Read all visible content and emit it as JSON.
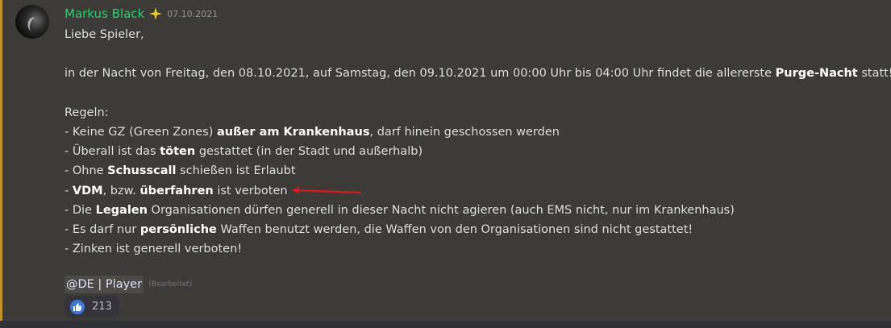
{
  "message": {
    "author": "Markus Black",
    "timestamp": "07.10.2021",
    "badge_icon": "sparkle-icon",
    "lines": [
      {
        "segments": [
          {
            "text": "Liebe Spieler,",
            "bold": false
          }
        ]
      },
      {
        "segments": []
      },
      {
        "segments": [
          {
            "text": "in der Nacht von Freitag, den 08.10.2021, auf Samstag, den 09.10.2021 um 00:00 Uhr bis 04:00 Uhr findet die allererste ",
            "bold": false
          },
          {
            "text": "Purge-Nacht",
            "bold": true
          },
          {
            "text": " statt!",
            "bold": false
          }
        ]
      },
      {
        "segments": []
      },
      {
        "segments": [
          {
            "text": "Regeln:",
            "bold": false
          }
        ]
      },
      {
        "segments": [
          {
            "text": "- Keine GZ (Green Zones) ",
            "bold": false
          },
          {
            "text": "außer am Krankenhaus",
            "bold": true
          },
          {
            "text": ", darf hinein geschossen werden",
            "bold": false
          }
        ]
      },
      {
        "segments": [
          {
            "text": "- Überall ist das ",
            "bold": false
          },
          {
            "text": "töten",
            "bold": true
          },
          {
            "text": " gestattet (in der Stadt und außerhalb)",
            "bold": false
          }
        ]
      },
      {
        "segments": [
          {
            "text": "- Ohne ",
            "bold": false
          },
          {
            "text": "Schusscall",
            "bold": true
          },
          {
            "text": " schießen ist Erlaubt",
            "bold": false
          }
        ]
      },
      {
        "segments": [
          {
            "text": "- ",
            "bold": false
          },
          {
            "text": "VDM",
            "bold": true
          },
          {
            "text": ", bzw. ",
            "bold": false
          },
          {
            "text": "überfahren",
            "bold": true
          },
          {
            "text": " ist verboten",
            "bold": false
          }
        ]
      },
      {
        "segments": [
          {
            "text": "- Die ",
            "bold": false
          },
          {
            "text": "Legalen",
            "bold": true
          },
          {
            "text": " Organisationen dürfen generell in dieser Nacht nicht agieren (auch EMS nicht, nur im Krankenhaus)",
            "bold": false
          }
        ]
      },
      {
        "segments": [
          {
            "text": "- Es darf nur ",
            "bold": false
          },
          {
            "text": "persönliche",
            "bold": true
          },
          {
            "text": " Waffen benutzt werden, die Waffen von den Organisationen sind nicht gestattet!",
            "bold": false
          }
        ]
      },
      {
        "segments": [
          {
            "text": "- Zinken ist generell verboten!",
            "bold": false
          }
        ]
      },
      {
        "segments": []
      }
    ],
    "mention": "@DE | Player",
    "edited_label": "(Bearbeitet)",
    "reaction": {
      "emoji_icon": "thumbs-up-icon",
      "count": "213"
    },
    "annotation_icon": "red-arrow-icon"
  },
  "colors": {
    "username": "#2ecc71",
    "mention_bar": "#c69220",
    "background": "#3d3b37",
    "arrow": "#e0161c",
    "reaction_emoji_bg": "#3b7ad9"
  }
}
